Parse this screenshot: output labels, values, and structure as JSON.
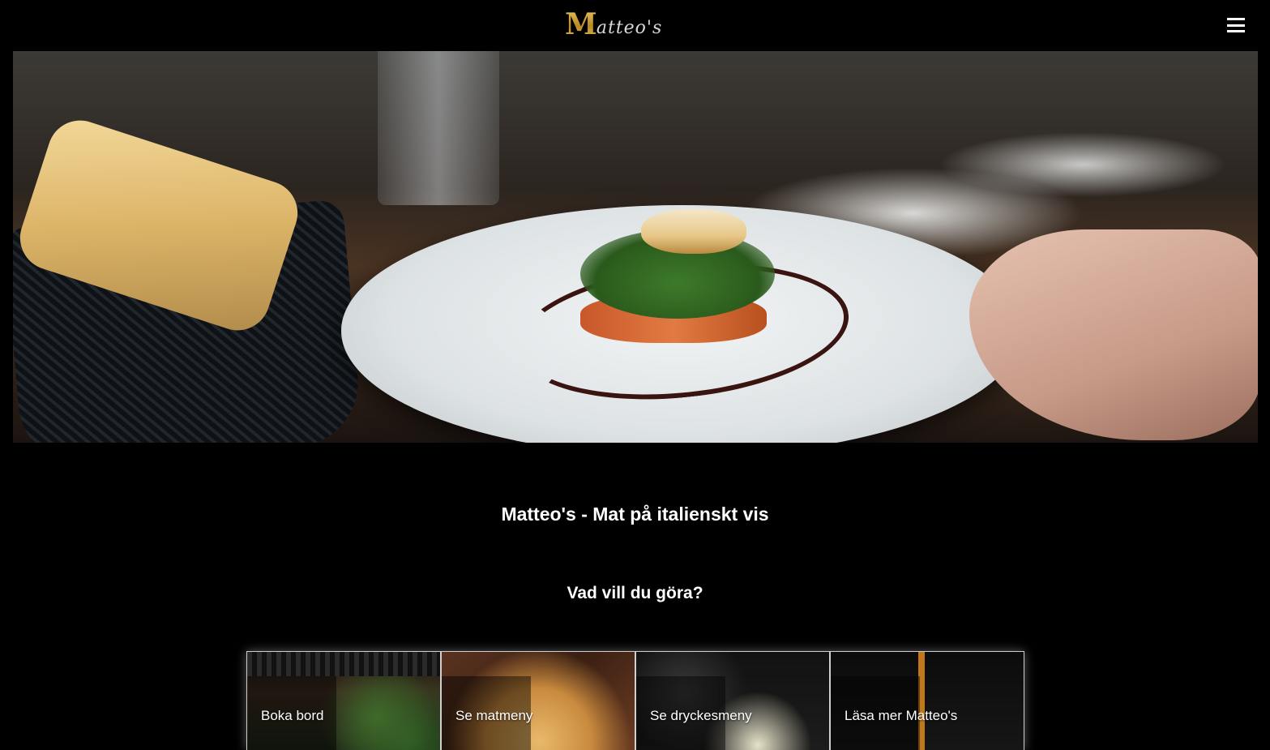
{
  "header": {
    "logo_initial": "M",
    "logo_rest": "atteo's",
    "menu_icon": "hamburger-icon"
  },
  "hero": {
    "image": "restaurant-plate-photo"
  },
  "main": {
    "title": "Matteo's - Mat på italienskt vis",
    "subtitle": "Vad vill du göra?",
    "tiles": [
      {
        "label": "Boka bord"
      },
      {
        "label": "Se matmeny"
      },
      {
        "label": "Se dryckesmeny"
      },
      {
        "label": "Läsa mer Matteo's"
      }
    ]
  },
  "colors": {
    "background": "#000000",
    "text": "#ffffff",
    "logo_gold": "#c9a13a"
  }
}
